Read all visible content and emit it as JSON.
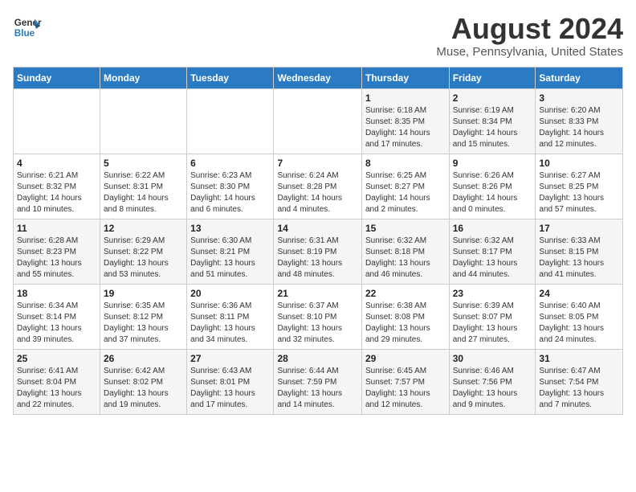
{
  "header": {
    "logo_line1": "General",
    "logo_line2": "Blue",
    "month_year": "August 2024",
    "location": "Muse, Pennsylvania, United States"
  },
  "weekdays": [
    "Sunday",
    "Monday",
    "Tuesday",
    "Wednesday",
    "Thursday",
    "Friday",
    "Saturday"
  ],
  "weeks": [
    [
      {
        "day": "",
        "detail": ""
      },
      {
        "day": "",
        "detail": ""
      },
      {
        "day": "",
        "detail": ""
      },
      {
        "day": "",
        "detail": ""
      },
      {
        "day": "1",
        "detail": "Sunrise: 6:18 AM\nSunset: 8:35 PM\nDaylight: 14 hours\nand 17 minutes."
      },
      {
        "day": "2",
        "detail": "Sunrise: 6:19 AM\nSunset: 8:34 PM\nDaylight: 14 hours\nand 15 minutes."
      },
      {
        "day": "3",
        "detail": "Sunrise: 6:20 AM\nSunset: 8:33 PM\nDaylight: 14 hours\nand 12 minutes."
      }
    ],
    [
      {
        "day": "4",
        "detail": "Sunrise: 6:21 AM\nSunset: 8:32 PM\nDaylight: 14 hours\nand 10 minutes."
      },
      {
        "day": "5",
        "detail": "Sunrise: 6:22 AM\nSunset: 8:31 PM\nDaylight: 14 hours\nand 8 minutes."
      },
      {
        "day": "6",
        "detail": "Sunrise: 6:23 AM\nSunset: 8:30 PM\nDaylight: 14 hours\nand 6 minutes."
      },
      {
        "day": "7",
        "detail": "Sunrise: 6:24 AM\nSunset: 8:28 PM\nDaylight: 14 hours\nand 4 minutes."
      },
      {
        "day": "8",
        "detail": "Sunrise: 6:25 AM\nSunset: 8:27 PM\nDaylight: 14 hours\nand 2 minutes."
      },
      {
        "day": "9",
        "detail": "Sunrise: 6:26 AM\nSunset: 8:26 PM\nDaylight: 14 hours\nand 0 minutes."
      },
      {
        "day": "10",
        "detail": "Sunrise: 6:27 AM\nSunset: 8:25 PM\nDaylight: 13 hours\nand 57 minutes."
      }
    ],
    [
      {
        "day": "11",
        "detail": "Sunrise: 6:28 AM\nSunset: 8:23 PM\nDaylight: 13 hours\nand 55 minutes."
      },
      {
        "day": "12",
        "detail": "Sunrise: 6:29 AM\nSunset: 8:22 PM\nDaylight: 13 hours\nand 53 minutes."
      },
      {
        "day": "13",
        "detail": "Sunrise: 6:30 AM\nSunset: 8:21 PM\nDaylight: 13 hours\nand 51 minutes."
      },
      {
        "day": "14",
        "detail": "Sunrise: 6:31 AM\nSunset: 8:19 PM\nDaylight: 13 hours\nand 48 minutes."
      },
      {
        "day": "15",
        "detail": "Sunrise: 6:32 AM\nSunset: 8:18 PM\nDaylight: 13 hours\nand 46 minutes."
      },
      {
        "day": "16",
        "detail": "Sunrise: 6:32 AM\nSunset: 8:17 PM\nDaylight: 13 hours\nand 44 minutes."
      },
      {
        "day": "17",
        "detail": "Sunrise: 6:33 AM\nSunset: 8:15 PM\nDaylight: 13 hours\nand 41 minutes."
      }
    ],
    [
      {
        "day": "18",
        "detail": "Sunrise: 6:34 AM\nSunset: 8:14 PM\nDaylight: 13 hours\nand 39 minutes."
      },
      {
        "day": "19",
        "detail": "Sunrise: 6:35 AM\nSunset: 8:12 PM\nDaylight: 13 hours\nand 37 minutes."
      },
      {
        "day": "20",
        "detail": "Sunrise: 6:36 AM\nSunset: 8:11 PM\nDaylight: 13 hours\nand 34 minutes."
      },
      {
        "day": "21",
        "detail": "Sunrise: 6:37 AM\nSunset: 8:10 PM\nDaylight: 13 hours\nand 32 minutes."
      },
      {
        "day": "22",
        "detail": "Sunrise: 6:38 AM\nSunset: 8:08 PM\nDaylight: 13 hours\nand 29 minutes."
      },
      {
        "day": "23",
        "detail": "Sunrise: 6:39 AM\nSunset: 8:07 PM\nDaylight: 13 hours\nand 27 minutes."
      },
      {
        "day": "24",
        "detail": "Sunrise: 6:40 AM\nSunset: 8:05 PM\nDaylight: 13 hours\nand 24 minutes."
      }
    ],
    [
      {
        "day": "25",
        "detail": "Sunrise: 6:41 AM\nSunset: 8:04 PM\nDaylight: 13 hours\nand 22 minutes."
      },
      {
        "day": "26",
        "detail": "Sunrise: 6:42 AM\nSunset: 8:02 PM\nDaylight: 13 hours\nand 19 minutes."
      },
      {
        "day": "27",
        "detail": "Sunrise: 6:43 AM\nSunset: 8:01 PM\nDaylight: 13 hours\nand 17 minutes."
      },
      {
        "day": "28",
        "detail": "Sunrise: 6:44 AM\nSunset: 7:59 PM\nDaylight: 13 hours\nand 14 minutes."
      },
      {
        "day": "29",
        "detail": "Sunrise: 6:45 AM\nSunset: 7:57 PM\nDaylight: 13 hours\nand 12 minutes."
      },
      {
        "day": "30",
        "detail": "Sunrise: 6:46 AM\nSunset: 7:56 PM\nDaylight: 13 hours\nand 9 minutes."
      },
      {
        "day": "31",
        "detail": "Sunrise: 6:47 AM\nSunset: 7:54 PM\nDaylight: 13 hours\nand 7 minutes."
      }
    ]
  ]
}
